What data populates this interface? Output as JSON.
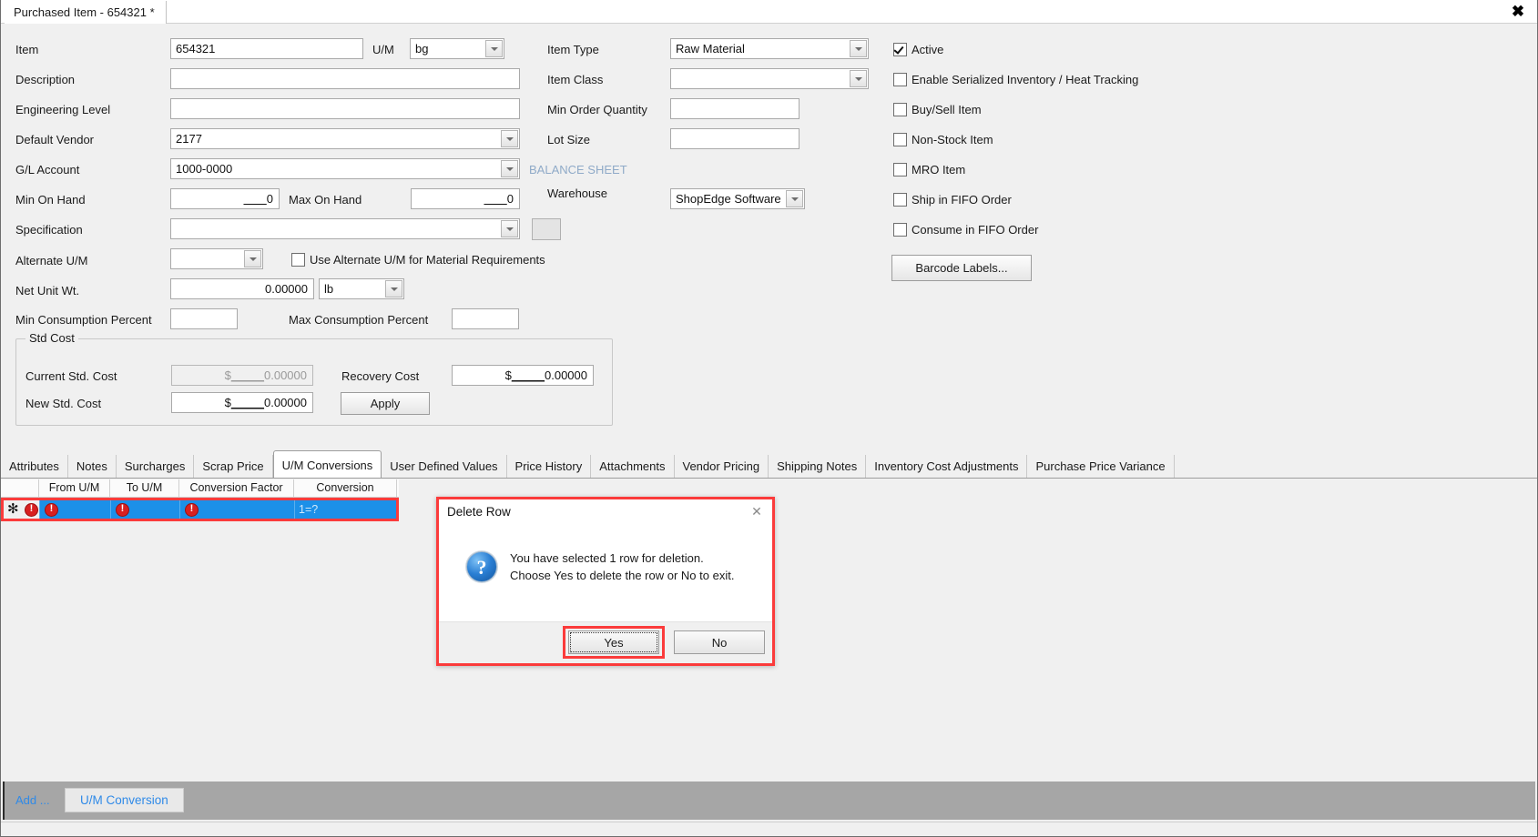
{
  "window": {
    "tab_title": "Purchased Item - 654321 *",
    "close_icon": "close-icon",
    "close_glyph": "✖"
  },
  "form": {
    "labels": {
      "item": "Item",
      "um": "U/M",
      "description": "Description",
      "engineering_level": "Engineering Level",
      "default_vendor": "Default Vendor",
      "gl_account": "G/L Account",
      "min_on_hand": "Min On Hand",
      "max_on_hand": "Max On Hand",
      "specification": "Specification",
      "alternate_um": "Alternate U/M",
      "net_unit_wt": "Net Unit Wt.",
      "min_consumption_percent": "Min Consumption Percent",
      "max_consumption_percent": "Max Consumption Percent",
      "item_type": "Item Type",
      "item_class": "Item Class",
      "min_order_quantity": "Min Order Quantity",
      "lot_size": "Lot Size",
      "warehouse": "Warehouse",
      "balance_sheet": "BALANCE SHEET"
    },
    "values": {
      "item": "654321",
      "um": "bg",
      "description": "",
      "engineering_level": "",
      "default_vendor": "2177",
      "gl_account": "1000-0000",
      "min_on_hand": "0",
      "max_on_hand": "0",
      "specification": "",
      "alternate_um": "",
      "net_unit_wt": "0.00000",
      "net_unit_wt_uom": "lb",
      "min_consumption_percent": "",
      "max_consumption_percent": "",
      "item_type": "Raw Material",
      "item_class": "",
      "min_order_quantity": "",
      "lot_size": "",
      "warehouse": "ShopEdge Software"
    },
    "checkbox_alt_um": "Use Alternate U/M for Material Requirements",
    "checkboxes": [
      {
        "label": "Active",
        "checked": true
      },
      {
        "label": "Enable Serialized Inventory / Heat Tracking",
        "checked": false
      },
      {
        "label": "Buy/Sell Item",
        "checked": false
      },
      {
        "label": "Non-Stock Item",
        "checked": false
      },
      {
        "label": "MRO Item",
        "checked": false
      },
      {
        "label": "Ship in FIFO Order",
        "checked": false
      },
      {
        "label": "Consume in FIFO Order",
        "checked": false
      }
    ],
    "barcode_button": "Barcode Labels...",
    "std_cost": {
      "group_title": "Std Cost",
      "current_label": "Current Std. Cost",
      "current_value": "0.00000",
      "new_label": "New Std. Cost",
      "new_value": "0.00000",
      "recovery_label": "Recovery Cost",
      "recovery_value": "0.00000",
      "apply_button": "Apply",
      "currency_symbol": "$",
      "pad": "_____"
    }
  },
  "tabs": [
    {
      "label": "Attributes",
      "active": false
    },
    {
      "label": "Notes",
      "active": false
    },
    {
      "label": "Surcharges",
      "active": false
    },
    {
      "label": "Scrap Price",
      "active": false
    },
    {
      "label": "U/M Conversions",
      "active": true
    },
    {
      "label": "User Defined Values",
      "active": false
    },
    {
      "label": "Price History",
      "active": false
    },
    {
      "label": "Attachments",
      "active": false
    },
    {
      "label": "Vendor Pricing",
      "active": false
    },
    {
      "label": "Shipping Notes",
      "active": false
    },
    {
      "label": "Inventory Cost Adjustments",
      "active": false
    },
    {
      "label": "Purchase Price Variance",
      "active": false
    }
  ],
  "grid": {
    "columns": [
      "From U/M",
      "To U/M",
      "Conversion Factor",
      "Conversion"
    ],
    "rows": [
      {
        "selected": true,
        "new_row_marker": "✻",
        "from_um": "",
        "to_um": "",
        "conversion_factor": "",
        "conversion": "1=?",
        "errors": [
          "row-error",
          "from-um-error",
          "to-um-error",
          "conversion-factor-error"
        ]
      }
    ]
  },
  "dialog": {
    "title": "Delete Row",
    "close_glyph": "✕",
    "icon": "question-icon",
    "message_line1": "You have selected 1 row for deletion.",
    "message_line2": "Choose Yes to delete the row or No to exit.",
    "yes_button": "Yes",
    "no_button": "No"
  },
  "statusbar": {
    "add_label": "Add ...",
    "um_conversion_button": "U/M Conversion"
  },
  "colors": {
    "highlight_red": "#fb3b3b",
    "selection_blue": "#1c90e8",
    "link_blue": "#2f8ae8",
    "balance_sheet_blue": "#8faac8",
    "error_red": "#d82020",
    "statusbar_gray": "#a6a6a6"
  }
}
